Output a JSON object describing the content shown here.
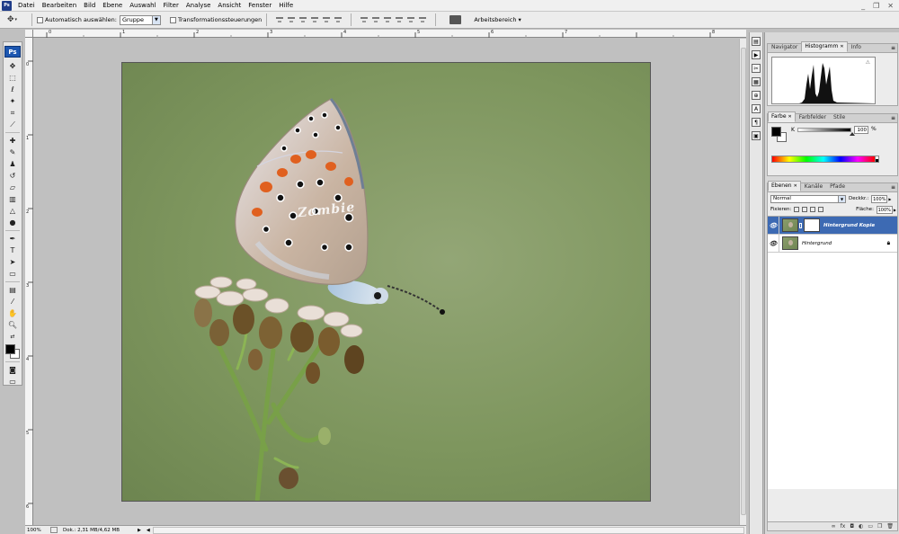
{
  "menubar": {
    "logo": "Ps",
    "items": [
      "Datei",
      "Bearbeiten",
      "Bild",
      "Ebene",
      "Auswahl",
      "Filter",
      "Analyse",
      "Ansicht",
      "Fenster",
      "Hilfe"
    ],
    "window_controls": [
      "_",
      "❐",
      "✕"
    ]
  },
  "options": {
    "auto_select_label": "Automatisch auswählen:",
    "auto_select_value": "Gruppe",
    "transform_label": "Transformationssteuerungen",
    "workspace_label": "Arbeitsbereich ▾"
  },
  "toolbox": {
    "badge": "Ps"
  },
  "rulers": {
    "top": [
      "0",
      "1",
      "2",
      "3",
      "4",
      "5",
      "6",
      "7",
      "8"
    ],
    "left": [
      "0",
      "1",
      "2",
      "3",
      "4",
      "5",
      "6"
    ]
  },
  "document": {
    "watermark": "Zombie"
  },
  "status": {
    "zoom": "100%",
    "doc_size": "Dok.: 2,31 MB/4,62 MB",
    "arrow": "▶",
    "scroll_left": "◀"
  },
  "panels": {
    "top_tabs": [
      {
        "label": "Navigator",
        "active": false
      },
      {
        "label": "Histogramm",
        "active": true
      },
      {
        "label": "Info",
        "active": false
      }
    ],
    "histogram_warning": "⚠",
    "color_tabs": [
      {
        "label": "Farbe",
        "active": true
      },
      {
        "label": "Farbfelder",
        "active": false
      },
      {
        "label": "Stile",
        "active": false
      }
    ],
    "color": {
      "channel": "K",
      "value": "100",
      "unit": "%",
      "fg": "#000000",
      "bg": "#ffffff"
    },
    "layer_tabs": [
      {
        "label": "Ebenen",
        "active": true
      },
      {
        "label": "Kanäle",
        "active": false
      },
      {
        "label": "Pfade",
        "active": false
      }
    ],
    "layers": {
      "blend_mode": "Normal",
      "opacity_label": "Deckkr.:",
      "opacity_value": "100%",
      "lock_label": "Fixieren:",
      "fill_label": "Fläche:",
      "fill_value": "100%",
      "items": [
        {
          "name": "Hintergrund Kopie",
          "selected": true,
          "has_mask": true,
          "locked": false
        },
        {
          "name": "Hintergrund",
          "selected": false,
          "has_mask": false,
          "locked": true
        }
      ],
      "footer_icons": [
        "∞",
        "fx",
        "◘",
        "◐",
        "▭",
        "❐",
        "🗑"
      ]
    }
  }
}
